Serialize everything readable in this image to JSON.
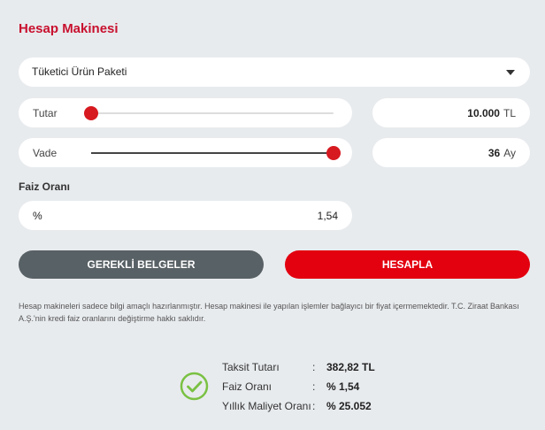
{
  "title": "Hesap Makinesi",
  "product_select": {
    "selected": "Tüketici Ürün Paketi"
  },
  "amount": {
    "label": "Tutar",
    "value": "10.000",
    "unit": "TL",
    "slider_fraction": 0.0
  },
  "term": {
    "label": "Vade",
    "value": "36",
    "unit": "Ay",
    "slider_fraction": 1.0
  },
  "interest": {
    "label": "Faiz Oranı",
    "prefix": "%",
    "value": "1,54"
  },
  "buttons": {
    "docs": "GEREKLİ BELGELER",
    "calculate": "HESAPLA"
  },
  "disclaimer": "Hesap makineleri sadece bilgi amaçlı hazırlanmıştır. Hesap makinesi ile yapılan işlemler bağlayıcı bir fiyat içermemektedir. T.C. Ziraat Bankası A.Ş.'nin kredi faiz oranlarını değiştirme hakkı saklıdır.",
  "results": {
    "colon": ":",
    "rows": [
      {
        "label": "Taksit Tutarı",
        "value": "382,82 TL"
      },
      {
        "label": "Faiz Oranı",
        "value": "% 1,54"
      },
      {
        "label": "Yıllık Maliyet Oranı",
        "value": "% 25.052"
      }
    ]
  },
  "colors": {
    "accent": "#e3000f",
    "title": "#c8102e",
    "check": "#7ac143",
    "docs_button": "#586165"
  },
  "icons": {
    "select_arrow": "caret-down-icon",
    "result": "check-circle-icon"
  }
}
